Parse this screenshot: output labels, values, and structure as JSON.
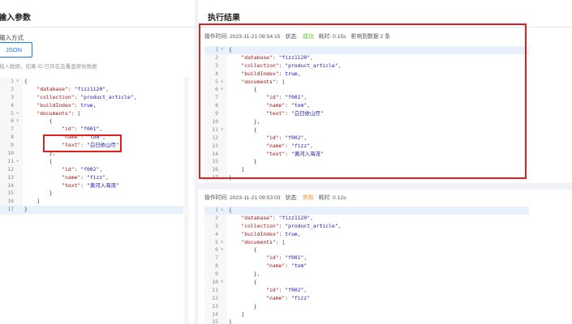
{
  "input": {
    "title": "输入参数",
    "mode_label": "输入方式",
    "json_button": "JSON",
    "hint": "插入数据，如果 ID 已存在会覆盖原始数据",
    "lines": [
      {
        "ln": "1",
        "fold": "v",
        "code": "{"
      },
      {
        "ln": "2",
        "fold": "",
        "code": "    \"database\": \"fizz1120\","
      },
      {
        "ln": "3",
        "fold": "",
        "code": "    \"collection\": \"product_article\","
      },
      {
        "ln": "4",
        "fold": "",
        "code": "    \"buildIndex\": true,"
      },
      {
        "ln": "5",
        "fold": "v",
        "code": "    \"documents\": ["
      },
      {
        "ln": "6",
        "fold": "v",
        "code": "        {"
      },
      {
        "ln": "7",
        "fold": "",
        "code": "            \"id\": \"f001\","
      },
      {
        "ln": "8",
        "fold": "",
        "code": "            \"name\": \"tom\","
      },
      {
        "ln": "9",
        "fold": "",
        "code": "            \"text\": \"白日依山尽\""
      },
      {
        "ln": "10",
        "fold": "",
        "code": "        },"
      },
      {
        "ln": "11",
        "fold": "v",
        "code": "        {"
      },
      {
        "ln": "12",
        "fold": "",
        "code": "            \"id\": \"f002\","
      },
      {
        "ln": "13",
        "fold": "",
        "code": "            \"name\": \"fizz\","
      },
      {
        "ln": "14",
        "fold": "",
        "code": "            \"text\": \"黄河入海流\""
      },
      {
        "ln": "15",
        "fold": "",
        "code": "        }"
      },
      {
        "ln": "16",
        "fold": "",
        "code": "    ]"
      },
      {
        "ln": "17",
        "fold": "",
        "code": "}"
      }
    ]
  },
  "results": {
    "title": "执行结果",
    "cards": [
      {
        "time_label": "操作时间: 2023-11-21 09:54:15",
        "status_prefix": "状态:",
        "status": "成功",
        "duration": "耗时: 0.15s",
        "affected": "影响到数据 2 条",
        "lines": [
          {
            "ln": "1",
            "fold": "v",
            "code": "{"
          },
          {
            "ln": "2",
            "fold": "",
            "code": "    \"database\": \"fizz1120\","
          },
          {
            "ln": "3",
            "fold": "",
            "code": "    \"collection\": \"product_article\","
          },
          {
            "ln": "4",
            "fold": "",
            "code": "    \"buildIndex\": true,"
          },
          {
            "ln": "5",
            "fold": "v",
            "code": "    \"documents\": ["
          },
          {
            "ln": "6",
            "fold": "v",
            "code": "        {"
          },
          {
            "ln": "7",
            "fold": "",
            "code": "            \"id\": \"f001\","
          },
          {
            "ln": "8",
            "fold": "",
            "code": "            \"name\": \"tom\","
          },
          {
            "ln": "9",
            "fold": "",
            "code": "            \"text\": \"白日依山尽\""
          },
          {
            "ln": "10",
            "fold": "",
            "code": "        },"
          },
          {
            "ln": "11",
            "fold": "v",
            "code": "        {"
          },
          {
            "ln": "12",
            "fold": "",
            "code": "            \"id\": \"f002\","
          },
          {
            "ln": "13",
            "fold": "",
            "code": "            \"name\": \"fizz\","
          },
          {
            "ln": "14",
            "fold": "",
            "code": "            \"text\": \"黄河入海流\""
          },
          {
            "ln": "15",
            "fold": "",
            "code": "        }"
          },
          {
            "ln": "16",
            "fold": "",
            "code": "    ]"
          },
          {
            "ln": "17",
            "fold": "",
            "code": "}"
          }
        ]
      },
      {
        "time_label": "操作时间: 2023-11-21 09:53:03",
        "status_prefix": "状态:",
        "status": "失败",
        "duration": "耗时: 0.12s",
        "affected": "",
        "lines": [
          {
            "ln": "1",
            "fold": "v",
            "code": "{"
          },
          {
            "ln": "2",
            "fold": "",
            "code": "    \"database\": \"fizz1120\","
          },
          {
            "ln": "3",
            "fold": "",
            "code": "    \"collection\": \"product_article\","
          },
          {
            "ln": "4",
            "fold": "",
            "code": "    \"buildIndex\": true,"
          },
          {
            "ln": "5",
            "fold": "v",
            "code": "    \"documents\": ["
          },
          {
            "ln": "6",
            "fold": "v",
            "code": "        {"
          },
          {
            "ln": "7",
            "fold": "",
            "code": "            \"id\": \"f001\","
          },
          {
            "ln": "8",
            "fold": "",
            "code": "            \"name\": \"tom\""
          },
          {
            "ln": "9",
            "fold": "",
            "code": "        },"
          },
          {
            "ln": "10",
            "fold": "v",
            "code": "        {"
          },
          {
            "ln": "11",
            "fold": "",
            "code": "            \"id\": \"f002\","
          },
          {
            "ln": "12",
            "fold": "",
            "code": "            \"name\": \"fizz\""
          },
          {
            "ln": "13",
            "fold": "",
            "code": "        }"
          },
          {
            "ln": "14",
            "fold": "",
            "code": "    ]"
          },
          {
            "ln": "15",
            "fold": "",
            "code": "}"
          }
        ]
      }
    ]
  },
  "colors": {
    "accent": "#1677ff",
    "success": "#52c41a",
    "fail": "#fa8c16",
    "highlight_box": "#e02020"
  }
}
